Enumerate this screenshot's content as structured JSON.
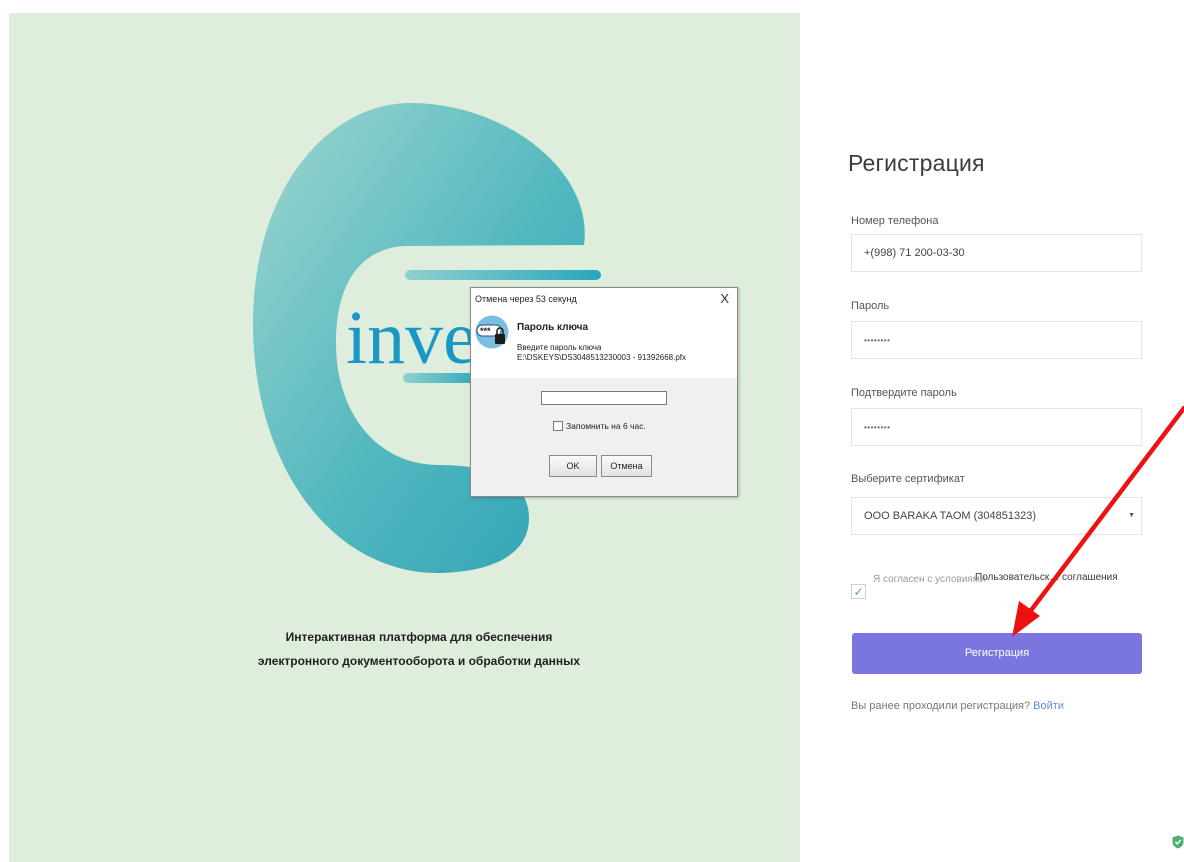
{
  "logo": {
    "text": "inve"
  },
  "tagline": {
    "line1": "Интерактивная платформа для обеспечения",
    "line2": "электронного документооборота и обработки данных"
  },
  "dialog": {
    "title": "Отмена через 53 секунд",
    "close": "X",
    "heading": "Пароль ключа",
    "prompt": "Введите пароль ключа",
    "path": "E:\\DSKEYS\\DS3048513230003 - 91392668.pfx",
    "password_value": "",
    "remember_label": "Запомнить на 6 час.",
    "ok_label": "OK",
    "cancel_label": "Отмена",
    "key_icon_text": "***"
  },
  "form": {
    "title": "Регистрация",
    "phone_label": "Номер телефона",
    "phone_value": "+(998) 71 200-03-30",
    "password_label": "Пароль",
    "password_value": "••••••••",
    "confirm_label": "Подтвердите пароль",
    "confirm_value": "••••••••",
    "cert_label": "Выберите сертификат",
    "cert_value": "ООО BARAKA TAOM (304851323)",
    "cert_arrow": "▼",
    "agree_text": "Я согласен с условиями",
    "agree_link": "Пользовательск… соглашения",
    "agree_check": "✓",
    "submit_label": "Регистрация",
    "login_prompt": "Вы ранее проходили регистрация?",
    "login_link": "Войти"
  },
  "colors": {
    "left_bg": "#dfeedc",
    "logo_teal": "#48b3bd",
    "submit_bg": "#7b75df",
    "arrow": "#ee1111",
    "link": "#5f8bd9"
  },
  "icons": [
    "key-lock-icon",
    "close-icon",
    "checkmark-icon",
    "dropdown-arrow-icon",
    "shield-check-icon",
    "annotation-arrow-icon"
  ]
}
